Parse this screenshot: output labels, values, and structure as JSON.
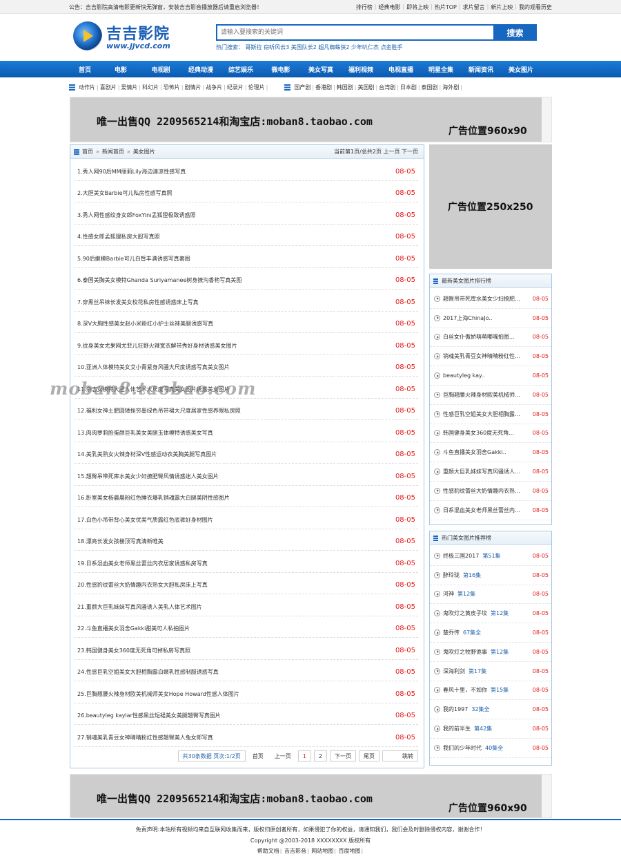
{
  "topbar": {
    "notice": "公告：吉吉影院高清电影更新快无弹窗，安装吉吉影音播放器后请重启浏览器！",
    "links": [
      "排行榜",
      "经典电影",
      "即将上映",
      "热片TOP",
      "求片留言",
      "新片上映",
      "我的观看历史"
    ]
  },
  "logo": {
    "name": "吉吉影院",
    "url": "www.jjvcd.com"
  },
  "search": {
    "placeholder": "请输入要搜索的关键词",
    "button": "搜索",
    "hot_label": "热门搜索：",
    "hot_words": [
      "哥斯拉",
      "窃听风云3",
      "美国队长2",
      "超凡蜘蛛侠2",
      "少年叭仁杰",
      "点金胜手"
    ]
  },
  "nav": [
    "首页",
    "电影",
    "电视剧",
    "经典动漫",
    "综艺娱乐",
    "微电影",
    "美女写真",
    "福利视频",
    "电视直播",
    "明星全集",
    "新闻资讯",
    "美女图片"
  ],
  "subnav": {
    "genres": [
      "动作片",
      "喜剧片",
      "爱情片",
      "科幻片",
      "恐怖片",
      "剧情片",
      "战争片",
      "纪录片",
      "伦理片"
    ],
    "regions": [
      "国产剧",
      "香港剧",
      "韩国剧",
      "美国剧",
      "台湾剧",
      "日本剧",
      "泰国剧",
      "海外剧"
    ]
  },
  "ads": {
    "banner_text": "唯一出售QQ 2209565214和淘宝店:moban8.taobao.com",
    "banner_size": "广告位置960x90",
    "side_size": "广告位置250x250"
  },
  "breadcrumb": {
    "items": [
      "首页",
      "新闻首页",
      "美女图片"
    ],
    "sep": "»",
    "page_info": "当前第1页/总共2页 上一页 下一页"
  },
  "articles": [
    {
      "title": "1.秀人网90后MM丽莉Lily海边清凉性感写真",
      "date": "08-05"
    },
    {
      "title": "2.大胆美女Barbie可儿私房性感写真照",
      "date": "08-05"
    },
    {
      "title": "3.秀人网性感纹身女郎FoxYini孟狐狸极致诱惑照",
      "date": "08-05"
    },
    {
      "title": "4.性感女郎孟狐狸私房大胆写真照",
      "date": "08-05"
    },
    {
      "title": "5.90后嫩模Barbie可儿白皙丰满诱惑写真套图",
      "date": "08-05"
    },
    {
      "title": "6.泰国美胸美女模特Ghanda Suriyamanee树身撩沟香艳写真美图",
      "date": "08-05"
    },
    {
      "title": "7.穿黑丝吊袜长发美女校花私房性感诱惑床上写真",
      "date": "08-05"
    },
    {
      "title": "8.深V大胸性感美女赵小米粉红小护士丝袜美腿诱惑写真",
      "date": "08-05"
    },
    {
      "title": "9.纹身美女尤果网尤菲儿狂野火辣宽衣解带秀好身材诱惑美女图片",
      "date": "08-05"
    },
    {
      "title": "10.亚洲人体模特美女艾小青紧身风骚大尺度诱惑写真美女图片",
      "date": "08-05"
    },
    {
      "title": "11.杂志女模特大胆人体艺术大尺度写真美女图片诱惑美女图片",
      "date": "08-05"
    },
    {
      "title": "12.福利女神土肥圆矮挫穷墨绿色吊带裙大尺度居家性感养眼私房照",
      "date": "08-05"
    },
    {
      "title": "13.肉肉萝莉脸蛋颜巨乳美女美腿玉体模特诱惑美女写真",
      "date": "08-05"
    },
    {
      "title": "14.美乳美熟女火辣身材深V性感运动衣美胸美腿写真图片",
      "date": "08-05"
    },
    {
      "title": "15.翘臀吊带死库水美女少妇撩肥臀风情诱惑迷人美女图片",
      "date": "08-05"
    },
    {
      "title": "16.卧室美女杨晨晨粉红色睡衣爆乳销魂露大白腿美阴性感图片",
      "date": "08-05"
    },
    {
      "title": "17.白色小吊带背心美女优美气质露红色底裤好身材图片",
      "date": "08-05"
    },
    {
      "title": "18.漂亮长发女孩楼顶写真清新唯美",
      "date": "08-05"
    },
    {
      "title": "19.日系混血美女老师黑丝蕾丝内衣居家诱惑私房写真",
      "date": "08-05"
    },
    {
      "title": "20.性感豹纹蕾丝大奶情趣内衣熟女大胆私房床上写真",
      "date": "08-05"
    },
    {
      "title": "21.重颜大巨乳妹妹写真风骚诱人美乳人体艺术图片",
      "date": "08-05"
    },
    {
      "title": "22.斗鱼直播美女羽舍Gakki甜美可人私拍图片",
      "date": "08-05"
    },
    {
      "title": "23.韩国健身美女360度无死角可掉私房写真照",
      "date": "08-05"
    },
    {
      "title": "24.性感巨乳空姐美女大胆相胸露白嫩乳性感制服诱惑写真",
      "date": "08-05"
    },
    {
      "title": "25.巨胸翘腰火辣身材欧美机械师美女Hope Howard性感人体图片",
      "date": "08-05"
    },
    {
      "title": "26.beautyleg kaylar性感黑丝短裙美女美腿翘臀写真图片",
      "date": "08-05"
    },
    {
      "title": "27.销魂美乳青豆女神晴晴粉红性感翘臀美人兔女郎写真",
      "date": "08-05"
    }
  ],
  "pager": {
    "summary": "共30条数据 页次:1/2页",
    "first": "首页",
    "prev": "上一页",
    "pages": [
      "1",
      "2"
    ],
    "next": "下一页",
    "last": "尾页",
    "jump": "跳转"
  },
  "latest": {
    "title": "最新美女图片排行榜",
    "items": [
      {
        "name": "翘臀吊带死库水美女少妇撩肥...",
        "date": "08-05"
      },
      {
        "name": "2017上海ChinaJo..",
        "date": "08-05"
      },
      {
        "name": "白丝女仆傲娇萌萌嘟嘴拍图...",
        "date": "08-05"
      },
      {
        "name": "销魂美乳青豆女神晴晴粉红性...",
        "date": "08-05"
      },
      {
        "name": "beautyleg kay..",
        "date": "08-05"
      },
      {
        "name": "巨胸翘腰火辣身材欧美机械师...",
        "date": "08-05"
      },
      {
        "name": "性感巨乳空姐美女大胆相胸露...",
        "date": "08-05"
      },
      {
        "name": "韩国健身美女360度无死角...",
        "date": "08-05"
      },
      {
        "name": "斗鱼直播美女羽舍Gakki..",
        "date": "08-05"
      },
      {
        "name": "重颜大巨乳妹妹写真风骚诱人...",
        "date": "08-05"
      },
      {
        "name": "性感豹纹蕾丝大奶情趣内衣熟...",
        "date": "08-05"
      },
      {
        "name": "日系混血美女老师黑丝蕾丝内...",
        "date": "08-05"
      }
    ]
  },
  "hot": {
    "title": "热门美女图片推荐榜",
    "items": [
      {
        "name": "终极三国2017",
        "ep": "第51集",
        "date": "08-05"
      },
      {
        "name": "醉玲珑",
        "ep": "第16集",
        "date": "08-05"
      },
      {
        "name": "河神",
        "ep": "第12集",
        "date": "08-05"
      },
      {
        "name": "鬼吹灯之黄皮子坟",
        "ep": "第12集",
        "date": "08-05"
      },
      {
        "name": "楚乔传",
        "ep": "67集全",
        "date": "08-05"
      },
      {
        "name": "鬼吹灯之牧野诡事",
        "ep": "第12集",
        "date": "08-05"
      },
      {
        "name": "深海利剑",
        "ep": "第17集",
        "date": "08-05"
      },
      {
        "name": "春风十里，不如你",
        "ep": "第15集",
        "date": "08-05"
      },
      {
        "name": "我的1997",
        "ep": "32集全",
        "date": "08-05"
      },
      {
        "name": "我的前半生",
        "ep": "第42集",
        "date": "08-05"
      },
      {
        "name": "我们的少年时代",
        "ep": "40集全",
        "date": "08-05"
      }
    ]
  },
  "watermark": "moban8.taobao.com",
  "footer": {
    "disclaimer": "免责声明:本站所有视频均来自互联网收集而来，版权归原创者所有，如果侵犯了你的权益，请通知我们，我们会及时删除侵权内容，谢谢合作！",
    "copyright": "Copyright @2003-2018 XXXXXXXX 版权所有",
    "links": [
      "帮助文档",
      "吉吉影音",
      "网站地图",
      "百度地图"
    ]
  }
}
